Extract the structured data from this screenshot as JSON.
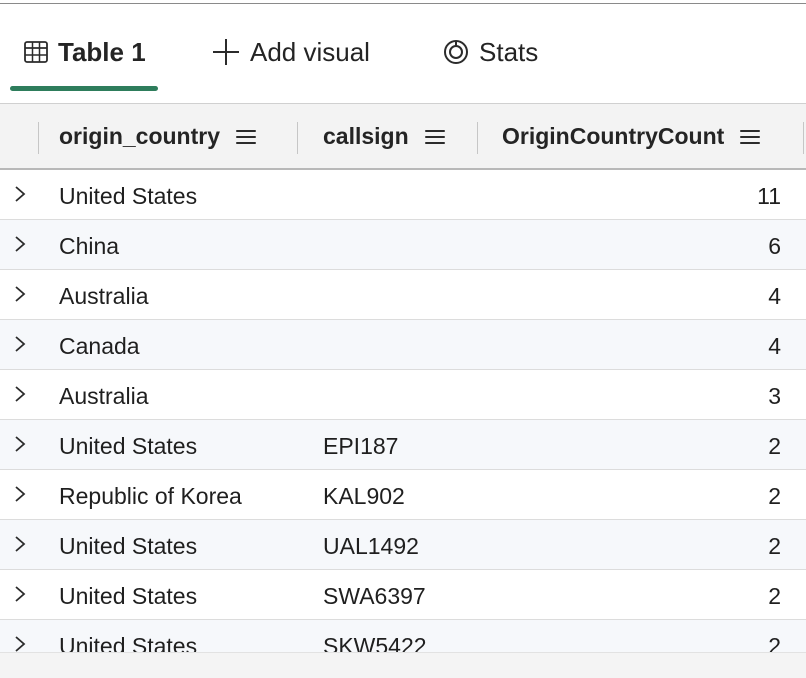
{
  "tabs": {
    "table_label": "Table 1",
    "add_visual_label": "Add visual",
    "stats_label": "Stats"
  },
  "columns": {
    "origin_country": "origin_country",
    "callsign": "callsign",
    "origin_country_count": "OriginCountryCount"
  },
  "rows": [
    {
      "origin_country": "United States",
      "callsign": "",
      "count": "11"
    },
    {
      "origin_country": "China",
      "callsign": "",
      "count": "6"
    },
    {
      "origin_country": "Australia",
      "callsign": "",
      "count": "4"
    },
    {
      "origin_country": "Canada",
      "callsign": "",
      "count": "4"
    },
    {
      "origin_country": "Australia",
      "callsign": "",
      "count": "3"
    },
    {
      "origin_country": "United States",
      "callsign": "EPI187",
      "count": "2"
    },
    {
      "origin_country": "Republic of Korea",
      "callsign": "KAL902",
      "count": "2"
    },
    {
      "origin_country": "United States",
      "callsign": "UAL1492",
      "count": "2"
    },
    {
      "origin_country": "United States",
      "callsign": "SWA6397",
      "count": "2"
    },
    {
      "origin_country": "United States",
      "callsign": "SKW5422",
      "count": "2"
    }
  ],
  "colors": {
    "accent": "#2e7d5c",
    "header_bg": "#f3f3f3",
    "alt_row_bg": "#f6f8fb"
  },
  "icons": {
    "table_tab": "table-grid-icon",
    "add_visual": "plus-icon",
    "stats": "stats-ring-icon",
    "column_menu": "hamburger-menu-icon",
    "row_expand": "chevron-right-icon"
  }
}
